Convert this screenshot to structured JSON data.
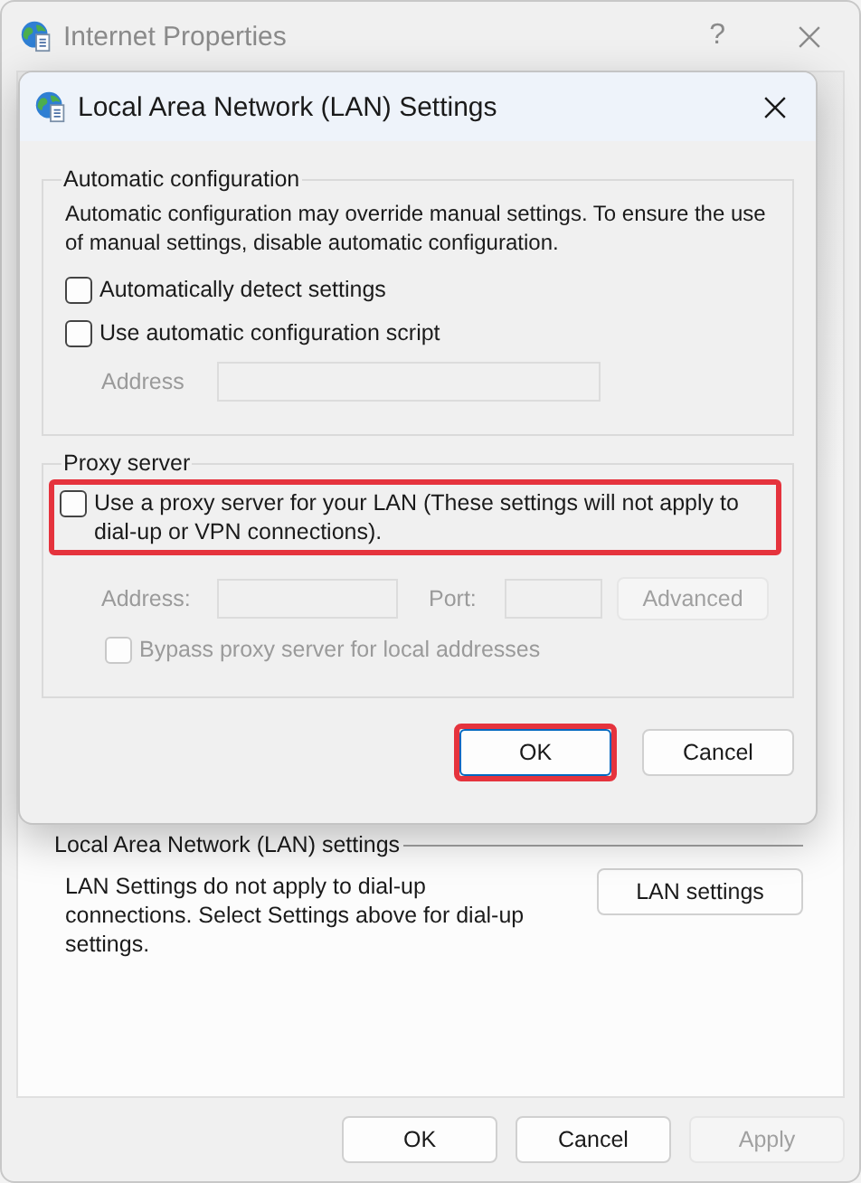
{
  "parent_window": {
    "title": "Internet Properties",
    "active": false,
    "help": "?",
    "lan_section": {
      "title": "Local Area Network (LAN) settings",
      "description": "LAN Settings do not apply to dial-up connections. Select Settings above for dial-up settings.",
      "button": "LAN settings"
    },
    "buttons": [
      {
        "label": "OK",
        "disabled": false
      },
      {
        "label": "Cancel",
        "disabled": false
      },
      {
        "label": "Apply",
        "disabled": true
      }
    ]
  },
  "dialog": {
    "title": "Local Area Network (LAN) Settings",
    "groups": [
      {
        "title": "Automatic configuration",
        "description": "Automatic configuration may override manual settings.  To ensure the use of manual settings, disable automatic configuration.",
        "items": [
          {
            "kind": "checkbox",
            "label": "Automatically detect settings",
            "checked": false,
            "disabled": false,
            "highlighted": false
          },
          {
            "kind": "checkbox",
            "label": "Use automatic configuration script",
            "checked": false,
            "disabled": false,
            "highlighted": false,
            "children": [
              {
                "kind": "address",
                "label": "Address",
                "disabled": true
              }
            ]
          }
        ]
      },
      {
        "title": "Proxy server",
        "items": [
          {
            "kind": "checkbox",
            "label": "Use a proxy server for your LAN (These settings will not apply to dial-up or VPN connections).",
            "checked": false,
            "disabled": false,
            "highlighted": true,
            "children": [
              {
                "kind": "proxy",
                "address_label": "Address:",
                "port_label": "Port:",
                "button": "Advanced",
                "disabled": true
              },
              {
                "kind": "checkbox",
                "label": "Bypass proxy server for local addresses",
                "checked": false,
                "disabled": true,
                "highlighted": false
              }
            ]
          }
        ]
      }
    ],
    "buttons": [
      {
        "label": "OK",
        "default": true,
        "highlighted": true
      },
      {
        "label": "Cancel",
        "default": false,
        "highlighted": false
      }
    ]
  }
}
